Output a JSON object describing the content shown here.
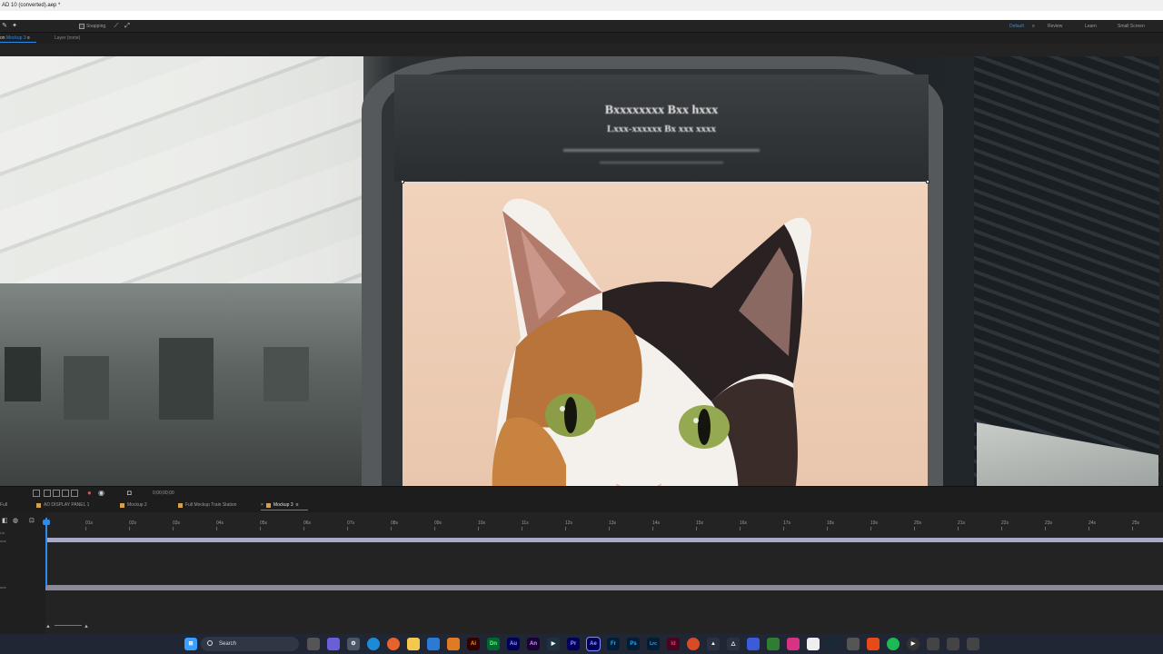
{
  "window": {
    "title": "AD 10 (converted).aep *"
  },
  "toolbar": {
    "snapping_label": "Snapping",
    "workspaces": [
      {
        "label": "Default",
        "active": true
      },
      {
        "label": "Review",
        "active": false
      },
      {
        "label": "Learn",
        "active": false
      },
      {
        "label": "Small Screen",
        "active": false
      }
    ]
  },
  "viewer": {
    "comp_prefix": "on",
    "comp_name": "Mockup 3",
    "layer_label": "Layer (none)",
    "billboard_line1": "Bxxxxxxxx Bxx hxxx",
    "billboard_line2": "Lxxx-xxxxxx Bx xxx xxxx"
  },
  "comp_tabs": [
    {
      "label": "Full",
      "active": false
    },
    {
      "label": "AD DISPLAY PANEL 1",
      "active": false
    },
    {
      "label": "Mockup 2",
      "active": false
    },
    {
      "label": "Full Mockup Train Station",
      "active": false
    },
    {
      "label": "Mockup 3",
      "active": true
    }
  ],
  "timecode": "0;00;00;00",
  "timeline": {
    "left_labels": [
      "Lin",
      "one",
      "one"
    ],
    "ruler_ticks": [
      "0s",
      "01s",
      "02s",
      "03s",
      "04s",
      "05s",
      "06s",
      "07s",
      "08s",
      "09s",
      "10s",
      "11s",
      "12s",
      "13s",
      "14s",
      "15s",
      "16s",
      "17s",
      "18s",
      "19s",
      "20s",
      "21s",
      "22s",
      "23s",
      "24s",
      "25s"
    ]
  },
  "taskbar": {
    "search_label": "Search",
    "apps": [
      "Ai",
      "Dn",
      "Au",
      "An",
      "Pr",
      "Ae",
      "Fr",
      "Ps",
      "Lrc",
      "Id"
    ]
  }
}
